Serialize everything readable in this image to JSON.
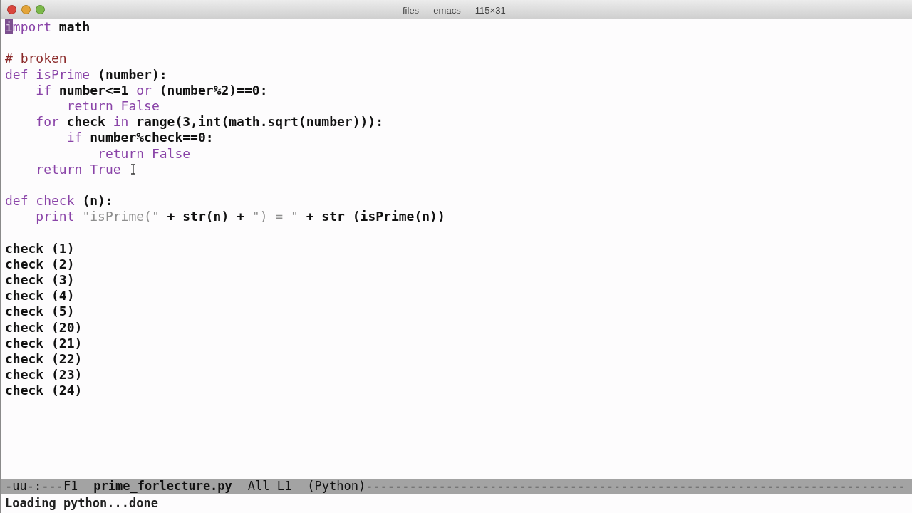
{
  "window": {
    "title": "files — emacs — 115×31"
  },
  "buffer": {
    "lines": [
      {
        "kind": "code",
        "tokens": [
          {
            "kind": "cursor",
            "text": "i"
          },
          {
            "kind": "kw",
            "text": "mport"
          },
          {
            "kind": "plain",
            "text": " math"
          }
        ]
      },
      {
        "kind": "blank"
      },
      {
        "kind": "code",
        "tokens": [
          {
            "kind": "comment",
            "text": "# broken"
          }
        ]
      },
      {
        "kind": "code",
        "tokens": [
          {
            "kind": "kw",
            "text": "def isPrime"
          },
          {
            "kind": "plain",
            "text": " (number):"
          }
        ]
      },
      {
        "kind": "code",
        "tokens": [
          {
            "kind": "kw",
            "text": "    if"
          },
          {
            "kind": "plain",
            "text": " number<=1 "
          },
          {
            "kind": "kw",
            "text": "or"
          },
          {
            "kind": "plain",
            "text": " (number%2)==0:"
          }
        ]
      },
      {
        "kind": "code",
        "tokens": [
          {
            "kind": "kw",
            "text": "        return False"
          }
        ]
      },
      {
        "kind": "code",
        "tokens": [
          {
            "kind": "kw",
            "text": "    for"
          },
          {
            "kind": "plain",
            "text": " check "
          },
          {
            "kind": "kw",
            "text": "in"
          },
          {
            "kind": "plain",
            "text": " range(3,int(math.sqrt(number))):"
          }
        ]
      },
      {
        "kind": "code",
        "tokens": [
          {
            "kind": "kw",
            "text": "        if"
          },
          {
            "kind": "plain",
            "text": " number%check==0:"
          }
        ]
      },
      {
        "kind": "code",
        "tokens": [
          {
            "kind": "kw",
            "text": "            return False"
          }
        ]
      },
      {
        "kind": "code",
        "tokens": [
          {
            "kind": "kw",
            "text": "    return True"
          }
        ]
      },
      {
        "kind": "blank"
      },
      {
        "kind": "code",
        "tokens": [
          {
            "kind": "kw",
            "text": "def check"
          },
          {
            "kind": "plain",
            "text": " (n):"
          }
        ]
      },
      {
        "kind": "code",
        "tokens": [
          {
            "kind": "kw",
            "text": "    print"
          },
          {
            "kind": "str",
            "text": " \"isPrime(\""
          },
          {
            "kind": "plain",
            "text": " + str(n) + "
          },
          {
            "kind": "str",
            "text": "\") = \""
          },
          {
            "kind": "plain",
            "text": " + str (isPrime(n))"
          }
        ]
      },
      {
        "kind": "blank"
      },
      {
        "kind": "code",
        "tokens": [
          {
            "kind": "plain",
            "text": "check (1)"
          }
        ]
      },
      {
        "kind": "code",
        "tokens": [
          {
            "kind": "plain",
            "text": "check (2)"
          }
        ]
      },
      {
        "kind": "code",
        "tokens": [
          {
            "kind": "plain",
            "text": "check (3)"
          }
        ]
      },
      {
        "kind": "code",
        "tokens": [
          {
            "kind": "plain",
            "text": "check (4)"
          }
        ]
      },
      {
        "kind": "code",
        "tokens": [
          {
            "kind": "plain",
            "text": "check (5)"
          }
        ]
      },
      {
        "kind": "code",
        "tokens": [
          {
            "kind": "plain",
            "text": "check (20)"
          }
        ]
      },
      {
        "kind": "code",
        "tokens": [
          {
            "kind": "plain",
            "text": "check (21)"
          }
        ]
      },
      {
        "kind": "code",
        "tokens": [
          {
            "kind": "plain",
            "text": "check (22)"
          }
        ]
      },
      {
        "kind": "code",
        "tokens": [
          {
            "kind": "plain",
            "text": "check (23)"
          }
        ]
      },
      {
        "kind": "code",
        "tokens": [
          {
            "kind": "plain",
            "text": "check (24)"
          }
        ]
      }
    ]
  },
  "mode_line": [
    {
      "text": "-uu-:---F1",
      "bold": false
    },
    {
      "text": "prime_forlecture.py",
      "bold": true
    },
    {
      "text": "All L1",
      "bold": false
    },
    {
      "text": "(Python)--------------------------------------------------------------------------",
      "bold": false
    }
  ],
  "echo_area": "Loading python...done"
}
